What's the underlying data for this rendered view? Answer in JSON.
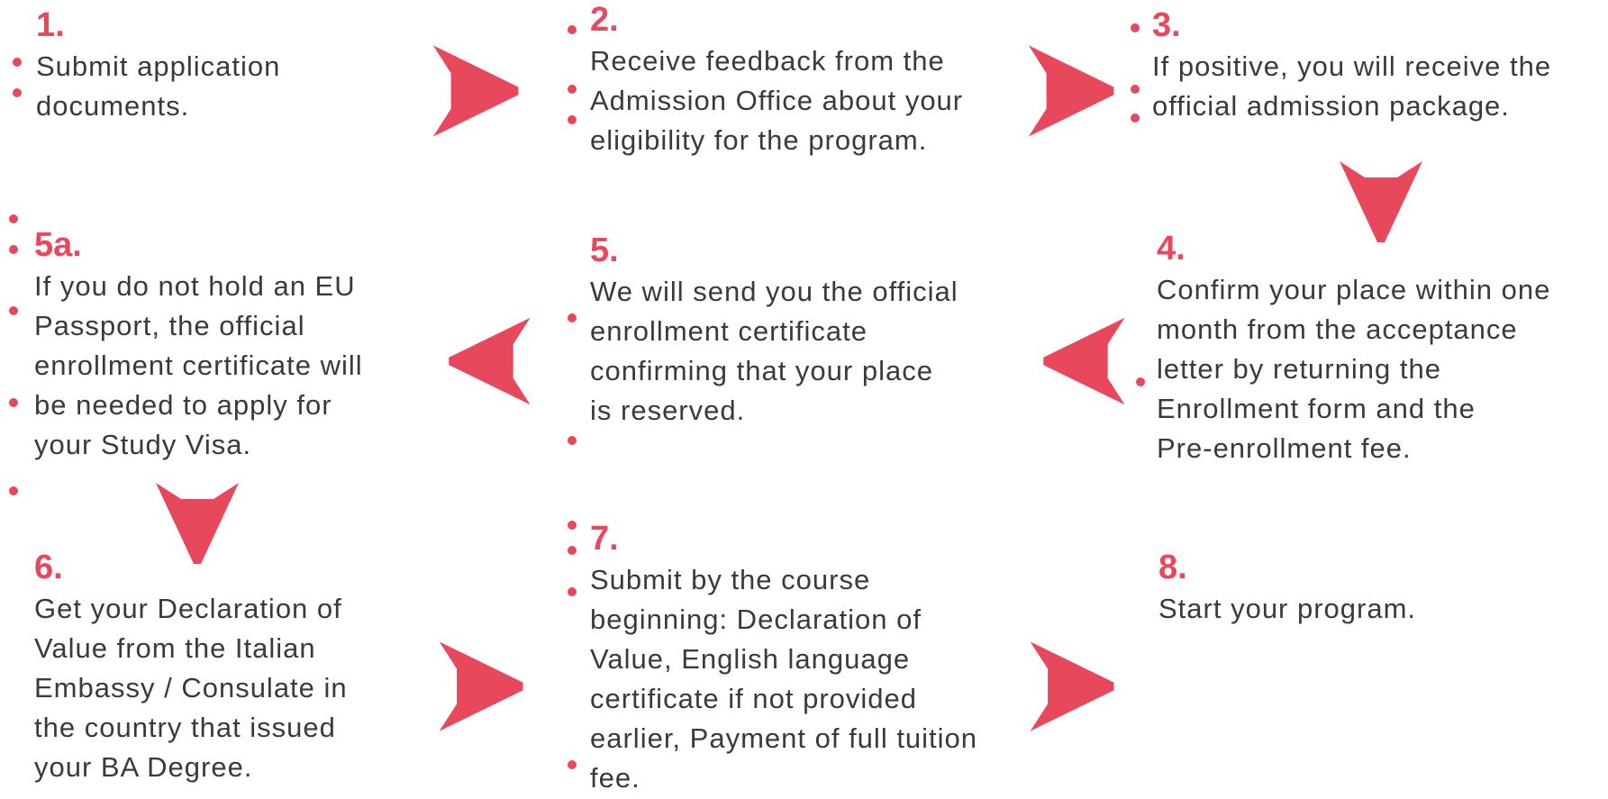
{
  "colors": {
    "accent": "#e8485b",
    "text": "#3a3a3a",
    "background": "#ffffff"
  },
  "steps": [
    {
      "num": "1.",
      "text": "Submit application\ndocuments."
    },
    {
      "num": "2.",
      "text": "Receive feedback from the\nAdmission Office about your\neligibility for the program."
    },
    {
      "num": "3.",
      "text": "If positive, you will receive the\nofficial admission package."
    },
    {
      "num": "4.",
      "text": "Confirm your place within one\nmonth from the acceptance\nletter by returning the\nEnrollment form and the\nPre-enrollment fee."
    },
    {
      "num": "5.",
      "text": "We will send you the official\nenrollment certificate\nconfirming that your place\nis reserved."
    },
    {
      "num": "5a.",
      "text": "If you do not hold an EU\nPassport, the official\nenrollment certificate will\nbe needed to apply for\nyour Study Visa."
    },
    {
      "num": "6.",
      "text": "Get your Declaration of\nValue from the Italian\nEmbassy / Consulate in\nthe country that issued\nyour BA Degree."
    },
    {
      "num": "7.",
      "text": "Submit by the course\nbeginning: Declaration of\nValue, English language\ncertificate if not provided\nearlier, Payment of full tuition\nfee."
    },
    {
      "num": "8.",
      "text": "Start your program."
    }
  ],
  "arrows": [
    {
      "name": "arrow-right-icon",
      "dir": "right"
    },
    {
      "name": "arrow-right-icon",
      "dir": "right"
    },
    {
      "name": "arrow-down-icon",
      "dir": "down"
    },
    {
      "name": "arrow-left-icon",
      "dir": "left"
    },
    {
      "name": "arrow-left-icon",
      "dir": "left"
    },
    {
      "name": "arrow-down-icon",
      "dir": "down"
    },
    {
      "name": "arrow-right-icon",
      "dir": "right"
    },
    {
      "name": "arrow-right-icon",
      "dir": "right"
    }
  ]
}
